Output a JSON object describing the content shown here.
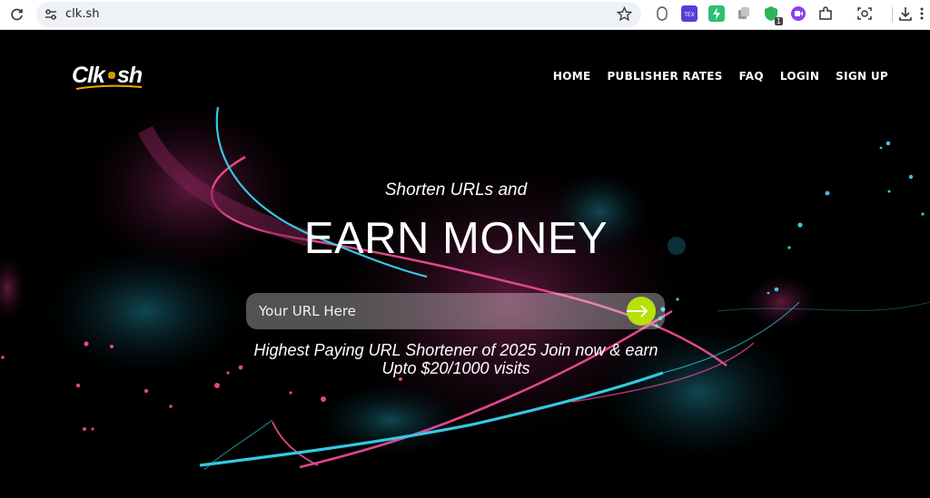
{
  "browser": {
    "url": "clk.sh",
    "extension_badge": "1"
  },
  "site": {
    "logo_text": "Clk.sh",
    "nav": [
      "HOME",
      "PUBLISHER RATES",
      "FAQ",
      "LOGIN",
      "SIGN UP"
    ]
  },
  "hero": {
    "subtitle": "Shorten URLs and",
    "headline": "EARN MONEY",
    "url_placeholder": "Your URL Here",
    "tagline_line1": "Highest Paying URL Shortener of 2025 Join now & earn",
    "tagline_line2": "Upto $20/1000 visits"
  },
  "colors": {
    "page_bg": "#000000",
    "accent_pink": "#e0468f",
    "accent_cyan": "#35c9e0",
    "submit_button": "#b9e00b",
    "logo_underline": "#f2a900"
  }
}
